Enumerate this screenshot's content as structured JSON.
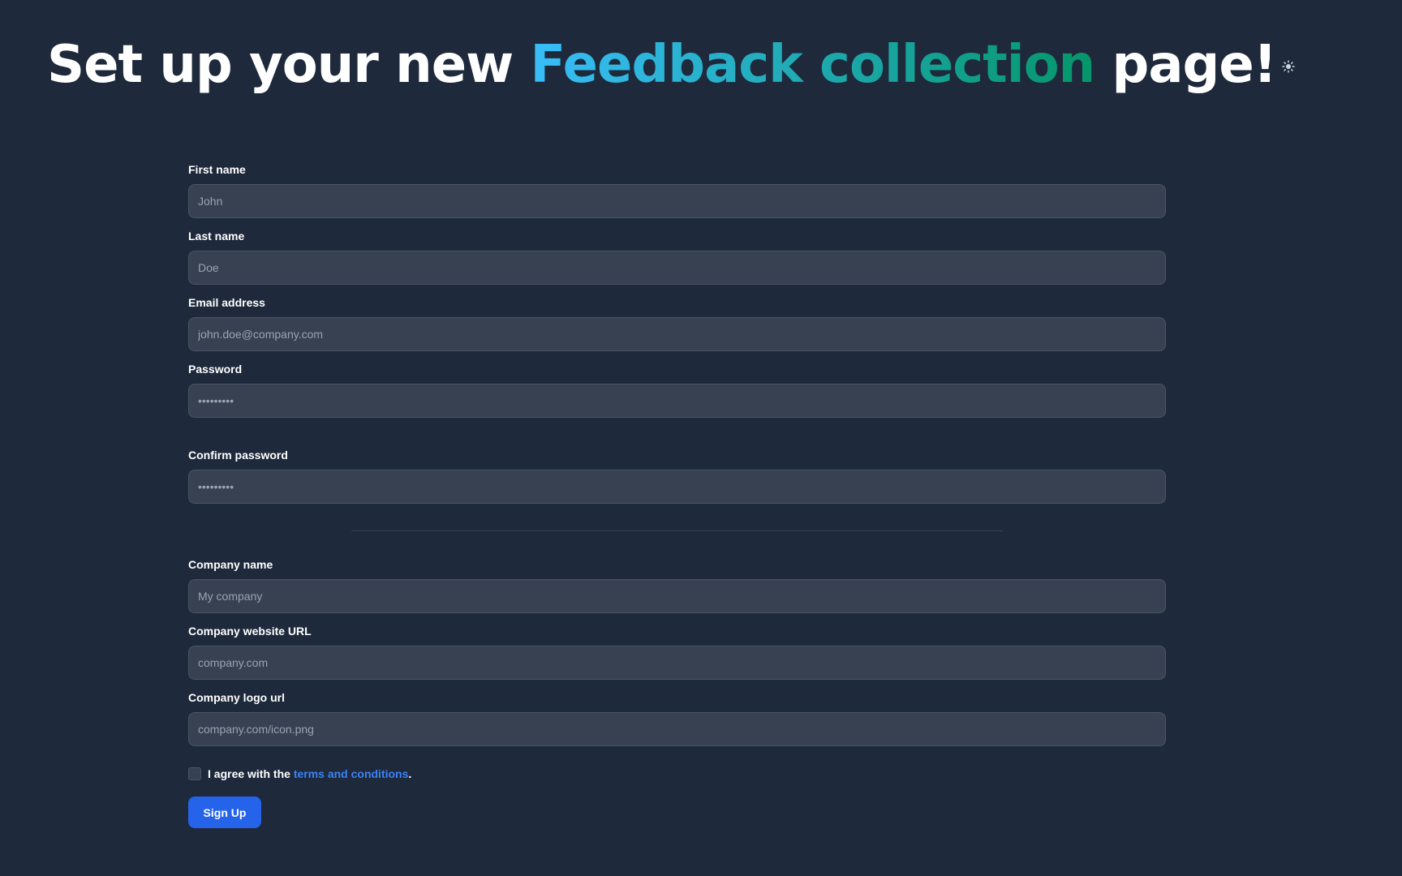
{
  "header": {
    "title_prefix": "Set up your new ",
    "title_highlight": "Feedback collection",
    "title_suffix": " page!",
    "gradient_from": "#38bdf8",
    "gradient_to": "#059669",
    "theme_toggle_icon": "sun-icon"
  },
  "form": {
    "fields": [
      {
        "label": "First name",
        "placeholder": "John",
        "type": "text"
      },
      {
        "label": "Last name",
        "placeholder": "Doe",
        "type": "text"
      },
      {
        "label": "Email address",
        "placeholder": "john.doe@company.com",
        "type": "email"
      },
      {
        "label": "Password",
        "placeholder": "•••••••••",
        "type": "password"
      },
      {
        "label": "Confirm password",
        "placeholder": "•••••••••",
        "type": "password"
      },
      {
        "label": "Company name",
        "placeholder": "My company",
        "type": "text"
      },
      {
        "label": "Company website URL",
        "placeholder": "company.com",
        "type": "text"
      },
      {
        "label": "Company logo url",
        "placeholder": "company.com/icon.png",
        "type": "text"
      }
    ],
    "terms": {
      "prefix": "I agree with the ",
      "link_text": "terms and conditions",
      "suffix": "."
    },
    "submit_label": "Sign Up"
  },
  "colors": {
    "background": "#1e293b",
    "input_bg": "#374151",
    "input_border": "#4b5563",
    "primary": "#2563eb",
    "link": "#3b82f6"
  }
}
